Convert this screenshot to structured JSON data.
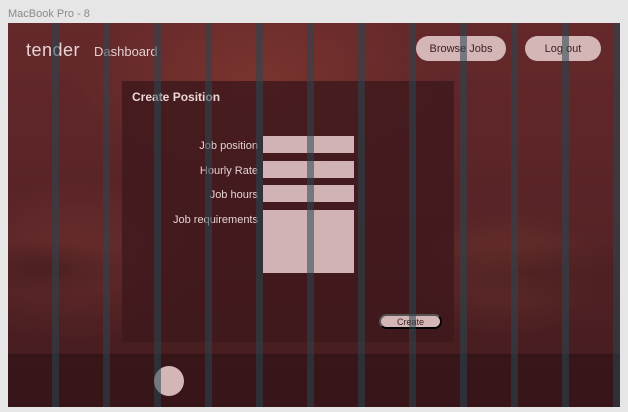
{
  "frame_label": "MacBook Pro - 8",
  "header": {
    "brand": "tender",
    "nav_current": "Dashboard",
    "browse_jobs_label": "Browse Jobs",
    "logout_label": "Log out"
  },
  "form": {
    "title": "Create Position",
    "fields": {
      "job_position": {
        "label": "Job position",
        "value": ""
      },
      "hourly_rate": {
        "label": "Hourly Rate",
        "value": ""
      },
      "job_hours": {
        "label": "Job hours",
        "value": ""
      },
      "job_requirements": {
        "label": "Job requirements",
        "value": ""
      }
    },
    "submit_label": "Create"
  },
  "colors": {
    "accent": "#d4b6b7",
    "panel": "#3e191c",
    "overlay": "#5f282c",
    "grid_column": "#284650"
  },
  "icons": {
    "avatar": "avatar-circle"
  }
}
